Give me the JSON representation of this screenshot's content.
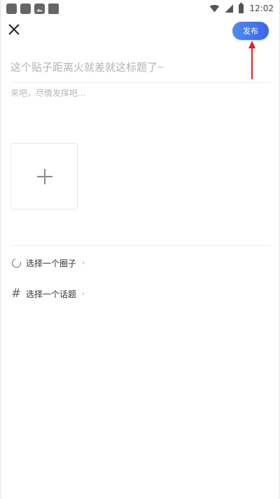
{
  "status_bar": {
    "time": "12:02",
    "left_icons": [
      "app-icon",
      "app-icon",
      "gallery-icon",
      "square-icon"
    ],
    "right_icons": [
      "wifi-icon",
      "signal-icon",
      "battery-icon"
    ]
  },
  "header": {
    "close_icon": "close-icon",
    "publish_label": "发布",
    "publish_color_start": "#4a8cf3",
    "publish_color_end": "#3f63e8"
  },
  "annotation": {
    "arrow_color": "#e8201e"
  },
  "editor": {
    "title_placeholder": "这个贴子距离火就差就这标题了~",
    "title_value": "",
    "content_placeholder": "来吧，尽情发挥吧...",
    "content_value": ""
  },
  "media": {
    "add_icon": "plus-icon"
  },
  "options": {
    "circle_label": "选择一个圈子",
    "topic_label": "选择一个话题",
    "chevron": "›"
  }
}
